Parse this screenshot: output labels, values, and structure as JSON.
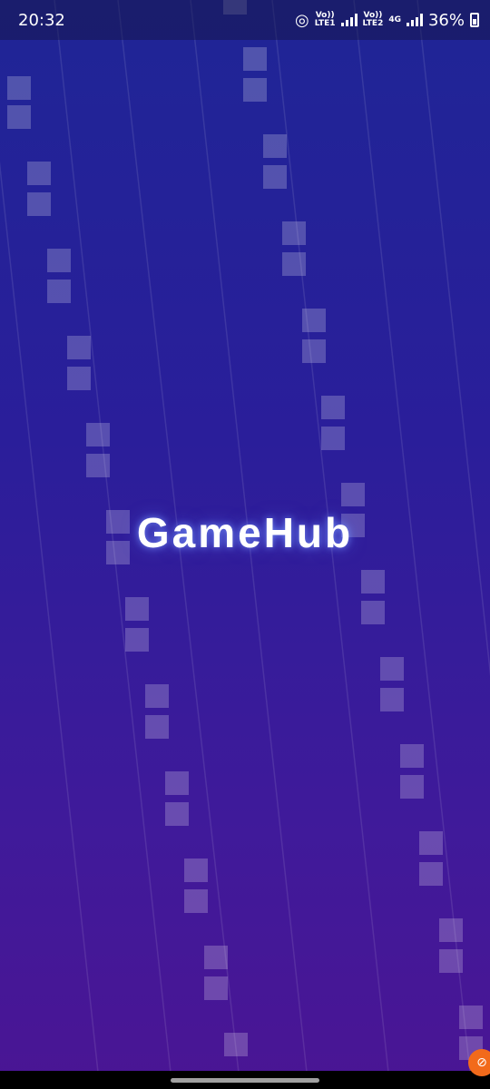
{
  "status_bar": {
    "time": "20:32",
    "sim1_top": "Vo))",
    "sim1_bottom": "LTE1",
    "sim2_top": "Vo))",
    "sim2_bottom": "LTE2",
    "network": "4G",
    "battery": "36%"
  },
  "app": {
    "title": "GameHub"
  },
  "icons": {
    "hotspot": "hotspot-icon",
    "signal": "signal-icon",
    "battery": "battery-icon",
    "floating": "floating-bubble-icon"
  },
  "colors": {
    "background_top": "#1f2596",
    "background_bottom": "#4a1594",
    "block": "rgba(255,255,255,0.22)",
    "badge": "#f26a1b"
  }
}
